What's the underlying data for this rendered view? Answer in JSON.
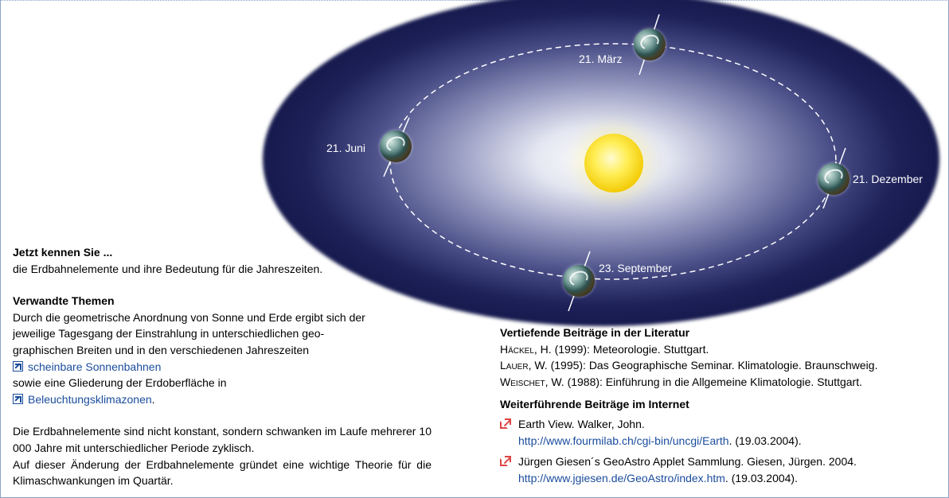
{
  "diagram": {
    "labels": {
      "maerz": "21. März",
      "juni": "21. Juni",
      "dezember": "21. Dezember",
      "september": "23. September"
    }
  },
  "left": {
    "heading1": "Jetzt kennen Sie ...",
    "line1": "die Erdbahnelemente und ihre Bedeutung für die Jahreszeiten.",
    "heading2": "Verwandte Themen",
    "para1_l1": "Durch die geometrische Anordnung von Sonne und Erde ergibt sich der",
    "para1_l2": "jeweilige Tagesgang der Einstrahlung in unterschiedlichen geo-",
    "para1_l3": "graphischen Breiten und in den verschiedenen Jahreszeiten",
    "link1": "scheinbare Sonnenbahnen",
    "para1_l5": "sowie eine Gliederung der Erdoberfläche in",
    "link2": "Beleuchtungsklimazonen",
    "link2_suffix": ".",
    "para2": "Die Erdbahnelemente sind nicht konstant, sondern schwanken im Laufe mehrerer 10 000 Jahre mit unterschiedlicher Periode zyklisch.",
    "para3": "Auf dieser Änderung der Erdbahnelemente gründet eine wichtige Theorie für die Klimaschwankungen im Quartär."
  },
  "right": {
    "heading_lit": "Vertiefende Beiträge in der Literatur",
    "lit": [
      {
        "author": "Häckel",
        "rest": ", H. (1999): Meteorologie. Stuttgart."
      },
      {
        "author": "Lauer",
        "rest": ", W. (1995): Das Geographische Seminar. Klimatologie. Braunschweig."
      },
      {
        "author": "Weischet",
        "rest": ", W. (1988): Einführung in die Allgemeine Klimatologie. Stuttgart."
      }
    ],
    "heading_web": "Weiterführende Beiträge im Internet",
    "web": [
      {
        "title": "Earth View. Walker, John.",
        "url": "http://www.fourmilab.ch/cgi-bin/uncgi/Earth",
        "date": ". (19.03.2004)."
      },
      {
        "title": "Jürgen Giesen´s GeoAstro Applet Sammlung. Giesen, Jürgen. 2004.",
        "url": "http://www.jgiesen.de/GeoAstro/index.htm",
        "date": ". (19.03.2004)."
      }
    ]
  }
}
